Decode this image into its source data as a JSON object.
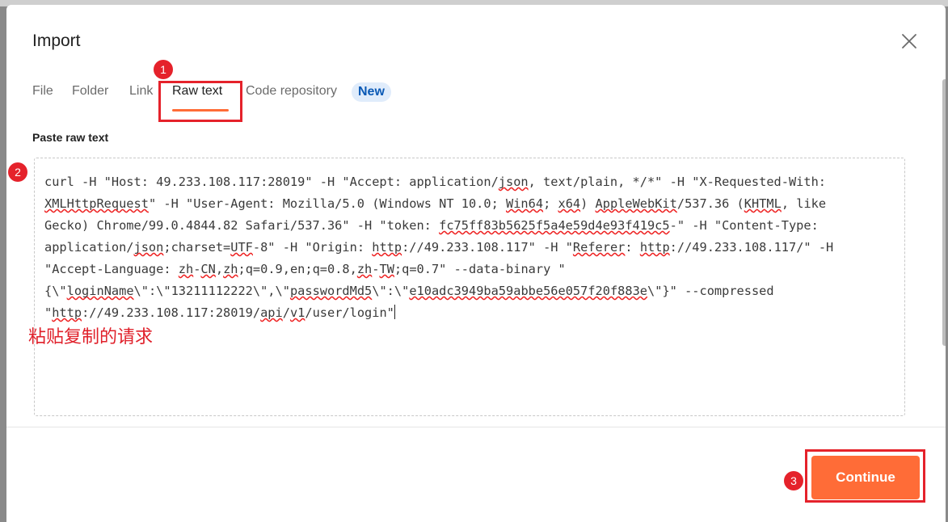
{
  "dialog": {
    "title": "Import",
    "close_icon": "close-icon"
  },
  "tabs": [
    {
      "label": "File"
    },
    {
      "label": "Folder"
    },
    {
      "label": "Link"
    },
    {
      "label": "Raw text",
      "active": true
    },
    {
      "label": "Code repository"
    }
  ],
  "badge_new": "New",
  "paste_label": "Paste raw text",
  "raw_text_lines": [
    "curl -H \"Host: 49.233.108.117:28019\" -H \"Accept: application/json, text/plain, */*\" -H \"X-Requested-With:",
    "XMLHttpRequest\" -H \"User-Agent: Mozilla/5.0 (Windows NT 10.0; Win64; x64) AppleWebKit/537.36 (KHTML, like",
    "Gecko) Chrome/99.0.4844.82 Safari/537.36\" -H \"token: fc75ff83b5625f5a4e59d4e93f419c5-\" -H \"Content-Type:",
    "application/json;charset=UTF-8\" -H \"Origin: http://49.233.108.117\" -H \"Referer: http://49.233.108.117/\" -H",
    "\"Accept-Language: zh-CN,zh;q=0.9,en;q=0.8,zh-TW;q=0.7\" --data-binary \"",
    "{\\\"loginName\\\":\\\"13211112222\\\",\\\"passwordMd5\\\":\\\"e10adc3949ba59abbe56e057f20f883e\\\"}\" --compressed",
    "\"http://49.233.108.117:28019/api/v1/user/login\""
  ],
  "annotation_text": "粘贴复制的请求",
  "continue_label": "Continue",
  "markers": [
    "1",
    "2",
    "3"
  ],
  "colors": {
    "accent": "#ff6c37",
    "annotation": "#e5222b",
    "badge_bg": "#e0ecfb",
    "badge_text": "#0a59b5"
  }
}
